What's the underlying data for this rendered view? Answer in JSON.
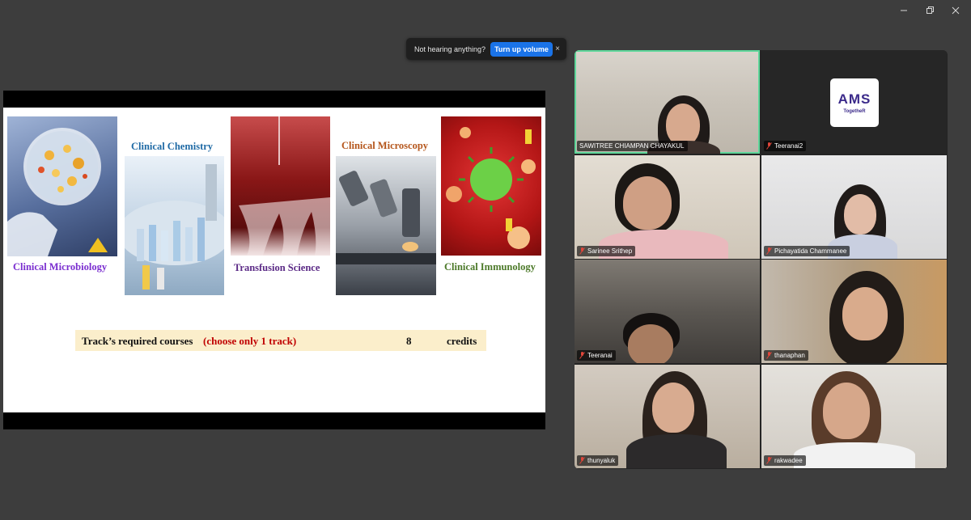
{
  "toast": {
    "message": "Not hearing anything?",
    "action_label": "Turn up volume",
    "close_label": "×"
  },
  "slide": {
    "captions": {
      "microbiology": "Clinical Microbiology",
      "chemistry": "Clinical Chemistry",
      "transfusion": "Transfusion Science",
      "microscopy": "Clinical Microscopy",
      "immunology": "Clinical Immunology"
    },
    "caption_colors": {
      "microbiology": "#7b2fd0",
      "chemistry": "#1f6aa5",
      "transfusion": "#5b2a86",
      "microscopy": "#b5561c",
      "immunology": "#4d7a2a"
    },
    "credits_row": {
      "label": "Track’s required courses",
      "highlight": "(choose only 1 track)",
      "highlight_color": "#c00000",
      "value": "8",
      "unit": "credits"
    }
  },
  "participants": [
    {
      "name": "SAWITREE CHIAMPAN CHAYAKUL",
      "muted": false,
      "active": true
    },
    {
      "name": "Teeranai2",
      "muted": true,
      "logo": {
        "main": "AMS",
        "sub": "TogetheR"
      }
    },
    {
      "name": "Sarinee Srithep",
      "muted": true
    },
    {
      "name": "Pichayatida Chammanee",
      "muted": true
    },
    {
      "name": "Teeranai",
      "muted": true
    },
    {
      "name": "thanaphan",
      "muted": true
    },
    {
      "name": "thunyaluk",
      "muted": true
    },
    {
      "name": "rakwadee",
      "muted": true
    }
  ],
  "colors": {
    "active_speaker_border": "#5ed79a",
    "muted_mic": "#e0463a",
    "toast_button": "#1a73e8"
  }
}
